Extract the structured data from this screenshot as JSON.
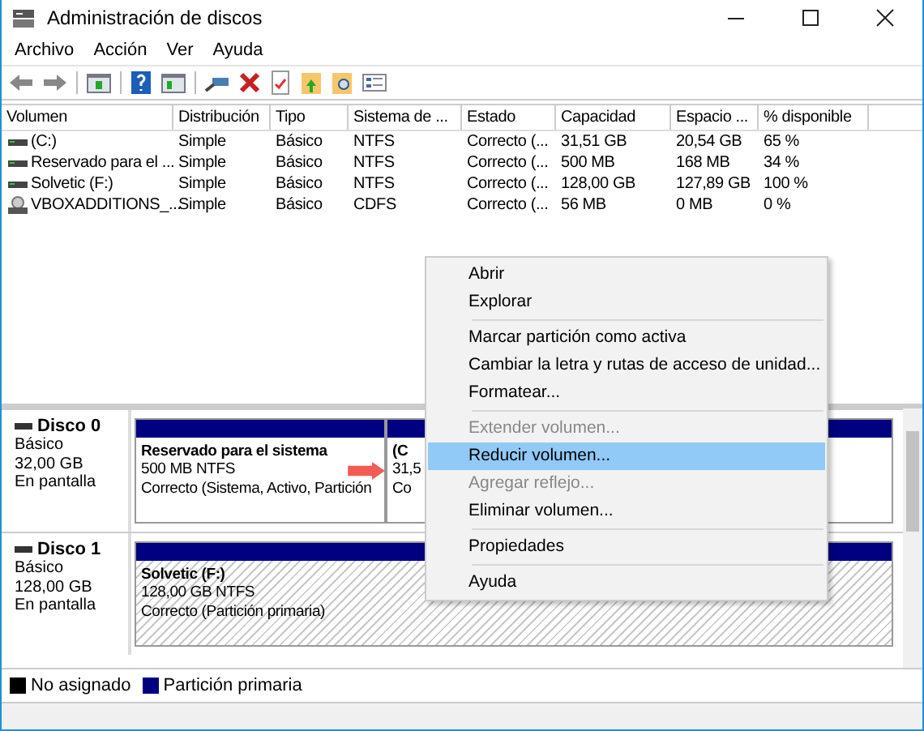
{
  "window": {
    "title": "Administración de discos"
  },
  "menu": [
    "Archivo",
    "Acción",
    "Ver",
    "Ayuda"
  ],
  "table": {
    "columns": [
      "Volumen",
      "Distribución",
      "Tipo",
      "Sistema de ...",
      "Estado",
      "Capacidad",
      "Espacio ...",
      "% disponible"
    ],
    "rows": [
      {
        "kind": "drive",
        "cells": [
          " (C:)",
          "Simple",
          "Básico",
          "NTFS",
          "Correcto (...",
          "31,51 GB",
          "20,54 GB",
          "65 %"
        ]
      },
      {
        "kind": "drive",
        "cells": [
          "Reservado para el ...",
          "Simple",
          "Básico",
          "NTFS",
          "Correcto (...",
          "500 MB",
          "168 MB",
          "34 %"
        ]
      },
      {
        "kind": "drive",
        "cells": [
          "Solvetic (F:)",
          "Simple",
          "Básico",
          "NTFS",
          "Correcto (...",
          "128,00 GB",
          "127,89 GB",
          "100 %"
        ]
      },
      {
        "kind": "cd",
        "cells": [
          "VBOXADDITIONS_...",
          "Simple",
          "Básico",
          "CDFS",
          "Correcto (...",
          "56 MB",
          "0 MB",
          "0 %"
        ]
      }
    ]
  },
  "disks": [
    {
      "name": "Disco 0",
      "type": "Básico",
      "size": "32,00 GB",
      "status": "En pantalla",
      "partitions": [
        {
          "name": "Reservado para el sistema",
          "size": "500 MB NTFS",
          "status": "Correcto (Sistema, Activo, Partición",
          "selected": false
        },
        {
          "name": "(C",
          "size": "31,5",
          "status": "Co",
          "selected": false
        }
      ]
    },
    {
      "name": "Disco 1",
      "type": "Básico",
      "size": "128,00 GB",
      "status": "En pantalla",
      "partitions": [
        {
          "name": "Solvetic  (F:)",
          "size": "128,00 GB NTFS",
          "status": "Correcto (Partición primaria)",
          "selected": true
        }
      ]
    }
  ],
  "legend": [
    {
      "label": "No asignado",
      "color": "#000000"
    },
    {
      "label": "Partición primaria",
      "color": "#000080"
    }
  ],
  "context_menu": {
    "items": [
      {
        "kind": "item",
        "label": "Abrir",
        "disabled": false,
        "selected": false
      },
      {
        "kind": "item",
        "label": "Explorar",
        "disabled": false,
        "selected": false
      },
      {
        "kind": "separator"
      },
      {
        "kind": "item",
        "label": "Marcar partición como activa",
        "disabled": false,
        "selected": false
      },
      {
        "kind": "item",
        "label": "Cambiar la letra y rutas de acceso de unidad...",
        "disabled": false,
        "selected": false
      },
      {
        "kind": "item",
        "label": "Formatear...",
        "disabled": false,
        "selected": false
      },
      {
        "kind": "separator"
      },
      {
        "kind": "item",
        "label": "Extender volumen...",
        "disabled": true,
        "selected": false
      },
      {
        "kind": "item",
        "label": "Reducir volumen...",
        "disabled": false,
        "selected": true
      },
      {
        "kind": "item",
        "label": "Agregar reflejo...",
        "disabled": true,
        "selected": false
      },
      {
        "kind": "item",
        "label": "Eliminar volumen...",
        "disabled": false,
        "selected": false
      },
      {
        "kind": "separator"
      },
      {
        "kind": "item",
        "label": "Propiedades",
        "disabled": false,
        "selected": false
      },
      {
        "kind": "separator"
      },
      {
        "kind": "item",
        "label": "Ayuda",
        "disabled": false,
        "selected": false
      }
    ]
  }
}
